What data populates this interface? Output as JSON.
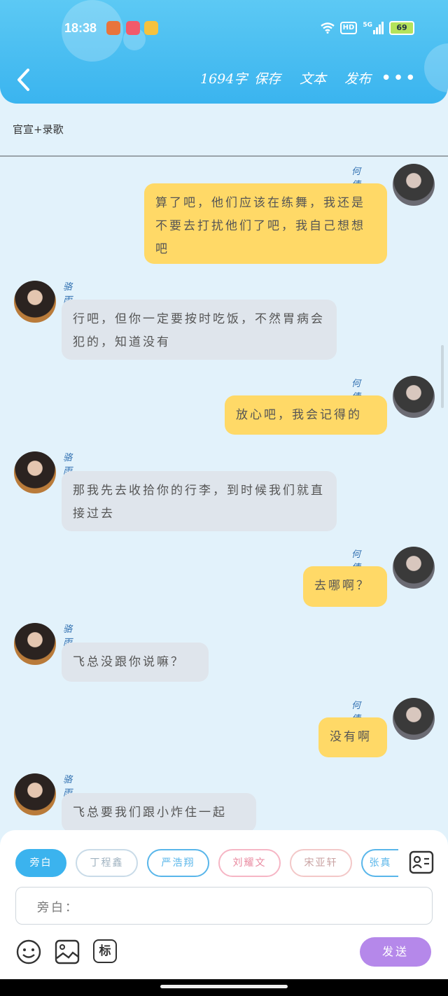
{
  "status_bar": {
    "time": "18:38",
    "signal": "5G",
    "hd": "HD",
    "battery": "69"
  },
  "header": {
    "word_count": "1694字",
    "save_label": "保存",
    "text_label": "文本",
    "publish_label": "发布",
    "more_label": "•••"
  },
  "title": "官宣+录歌",
  "messages": [
    {
      "side": "right",
      "name": "何倩桐",
      "text": "算了吧，他们应该在练舞，我还是不要去打扰他们了吧，我自己想想吧"
    },
    {
      "side": "left",
      "name": "骆雨琳",
      "text": "行吧，但你一定要按时吃饭，不然胃病会犯的，知道没有"
    },
    {
      "side": "right",
      "name": "何倩桐",
      "text": "放心吧，我会记得的"
    },
    {
      "side": "left",
      "name": "骆雨琳",
      "text": "那我先去收拾你的行李，到时候我们就直接过去"
    },
    {
      "side": "right",
      "name": "何倩桐",
      "text": "去哪啊？"
    },
    {
      "side": "left",
      "name": "骆雨琳",
      "text": "飞总没跟你说嘛？"
    },
    {
      "side": "right",
      "name": "何倩桐",
      "text": "没有啊"
    },
    {
      "side": "left",
      "name": "骆雨琳",
      "text": "飞总要我们跟小炸住一起"
    }
  ],
  "role_chips": [
    {
      "label": "旁白",
      "color": "#3bb3ee",
      "active": true
    },
    {
      "label": "丁程鑫",
      "color": "#c9dbe8"
    },
    {
      "label": "严浩翔",
      "color": "#59b6ea"
    },
    {
      "label": "刘耀文",
      "color": "#f6b6c5"
    },
    {
      "label": "宋亚轩",
      "color": "#f3c8c8"
    },
    {
      "label": "张真",
      "color": "#59b6ea"
    }
  ],
  "composer": {
    "input_label": "旁白：",
    "send_label": "发送",
    "tag_label": "标"
  },
  "icons": [
    "back-icon",
    "more-icon",
    "emoji-icon",
    "image-icon",
    "tag-icon",
    "contact-card-icon",
    "wifi-icon",
    "signal-icon",
    "battery-icon"
  ]
}
